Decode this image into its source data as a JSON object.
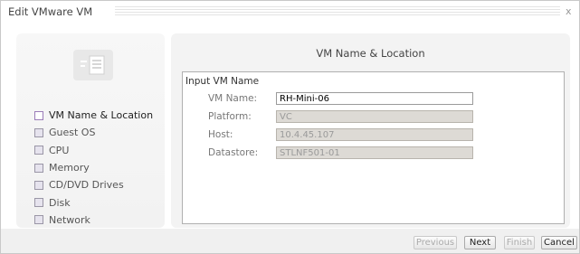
{
  "window": {
    "title": "Edit VMware VM",
    "close_glyph": "x"
  },
  "wizard": {
    "header_icon": "wizard-document-icon",
    "steps": [
      {
        "label": "VM Name & Location",
        "active": true
      },
      {
        "label": "Guest OS",
        "active": false
      },
      {
        "label": "CPU",
        "active": false
      },
      {
        "label": "Memory",
        "active": false
      },
      {
        "label": "CD/DVD Drives",
        "active": false
      },
      {
        "label": "Disk",
        "active": false
      },
      {
        "label": "Network",
        "active": false
      }
    ]
  },
  "main": {
    "header": "VM Name & Location",
    "group_title": "Input VM Name",
    "fields": {
      "vm_name": {
        "label": "VM Name:",
        "value": "RH-Mini-06"
      },
      "platform": {
        "label": "Platform:",
        "value": "VC"
      },
      "host": {
        "label": "Host:",
        "value": "10.4.45.107"
      },
      "datastore": {
        "label": "Datastore:",
        "value": "STLNF501-01"
      }
    }
  },
  "footer": {
    "previous": "Previous",
    "next": "Next",
    "finish": "Finish",
    "cancel": "Cancel"
  },
  "colors": {
    "step_box_border": "#9b7cb8",
    "panel_bg": "#f3f3f3",
    "readonly_bg": "#dddad5"
  }
}
